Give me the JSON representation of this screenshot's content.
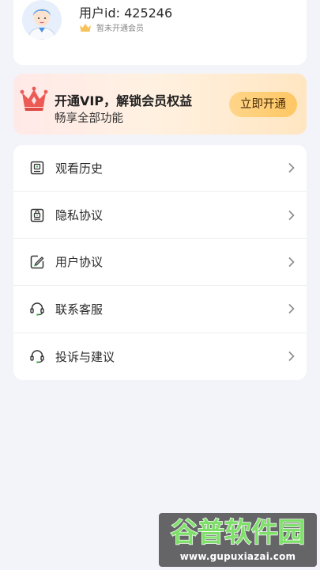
{
  "profile": {
    "user_id_text": "用户id: 425246",
    "membership_status": "暂未开通会员",
    "avatar_icon": "user-avatar-icon",
    "membership_icon": "crown-icon"
  },
  "vip_banner": {
    "title": "开通VIP，解锁会员权益",
    "subtitle": "畅享全部功能",
    "button_label": "立即开通",
    "icon": "vip-crown-icon"
  },
  "menu": {
    "items": [
      {
        "label": "观看历史",
        "icon": "history-icon"
      },
      {
        "label": "隐私协议",
        "icon": "lock-document-icon"
      },
      {
        "label": "用户协议",
        "icon": "edit-document-icon"
      },
      {
        "label": "联系客服",
        "icon": "headset-icon"
      },
      {
        "label": "投诉与建议",
        "icon": "feedback-headset-icon"
      }
    ],
    "chevron_icon": "chevron-right-icon"
  },
  "watermark": {
    "brand": "谷普软件园",
    "url": "www.gupuxiazai.com"
  },
  "colors": {
    "background": "#f3f4f9",
    "card": "#ffffff",
    "vip_button": "#ffc764",
    "icon_stroke": "#333333",
    "accent_green": "#37c24a"
  }
}
